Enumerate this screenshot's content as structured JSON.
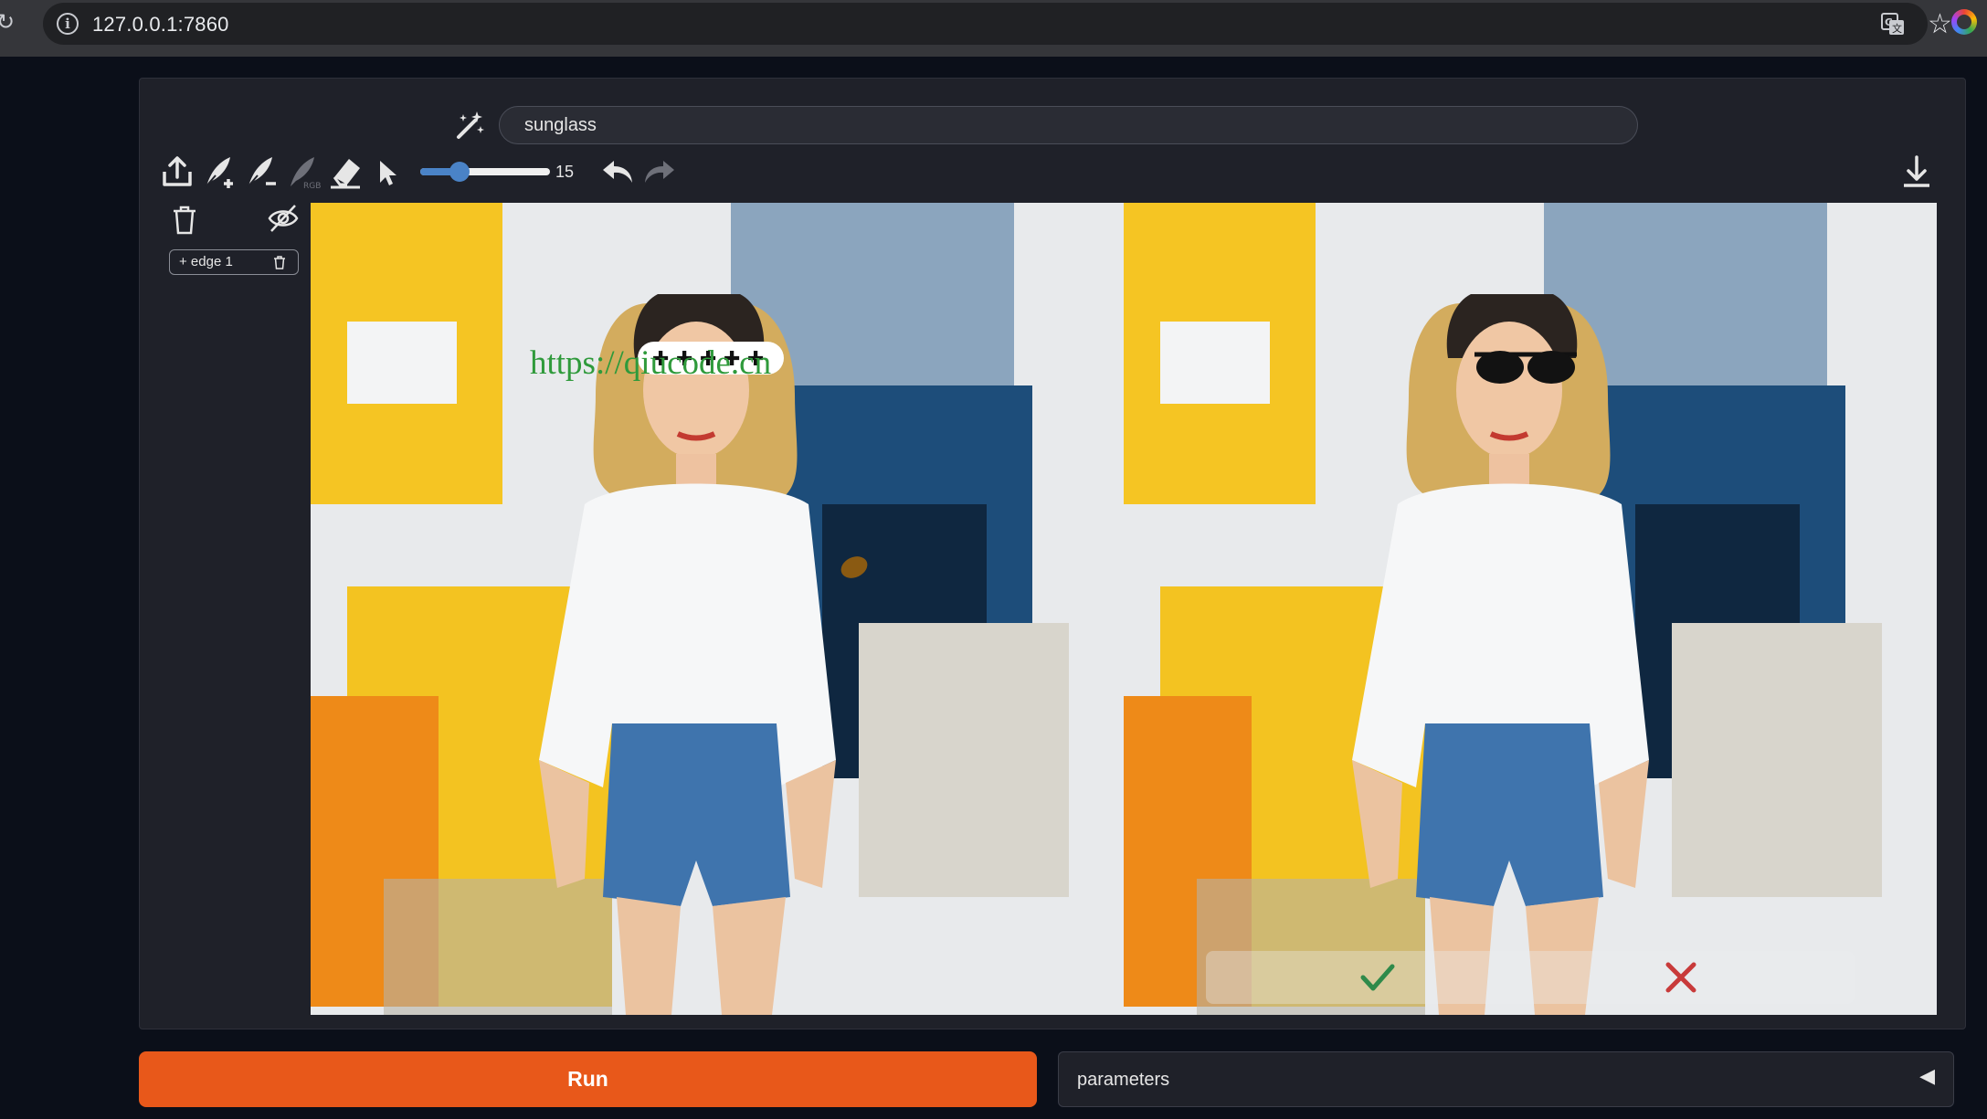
{
  "browser": {
    "url": "127.0.0.1:7860",
    "reload_icon": "reload-icon",
    "info_icon": "info-icon",
    "translate_icon": "translate-icon",
    "star_icon": "star-icon",
    "profile_icon": "profile-icon"
  },
  "editor": {
    "prompt_value": "sunglass",
    "magic_wand_icon": "magic-wand-icon",
    "toolbar": {
      "tools": [
        "upload-icon",
        "add-brush-icon",
        "remove-brush-icon",
        "rgb-brush-icon",
        "eraser-icon",
        "pointer-icon"
      ],
      "brush_size": 15,
      "brush_size_max": 50,
      "brush_size_label": "15",
      "undo_icon": "undo-icon",
      "redo_icon": "redo-icon",
      "download_icon": "download-icon"
    },
    "layers": {
      "delete_icon": "trash-icon",
      "visibility_icon": "eye-off-icon",
      "items": [
        {
          "label": "+ edge 1"
        }
      ]
    },
    "watermark_text": "https://qiucode.cn",
    "result_actions": {
      "accept_icon": "check-icon",
      "reject_icon": "close-icon"
    },
    "colors": {
      "accent": "#e8581a",
      "slider": "#4a83c7",
      "panel": "#1f2129"
    }
  },
  "footer": {
    "run_label": "Run",
    "parameters_label": "parameters",
    "parameters_caret": "◀"
  }
}
